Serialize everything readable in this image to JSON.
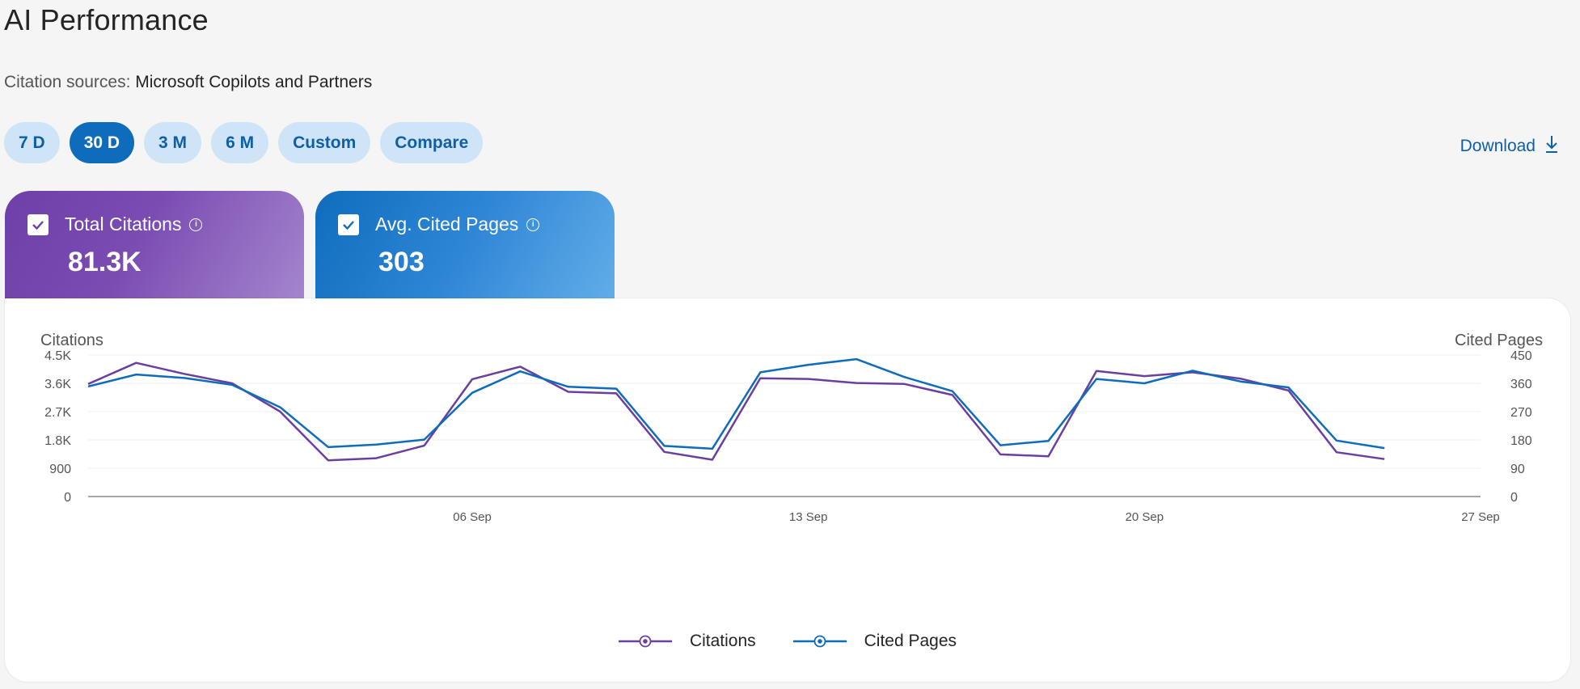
{
  "page": {
    "title": "AI Performance",
    "sources_label": "Citation sources:",
    "sources_value": "Microsoft Copilots and Partners",
    "download_label": "Download"
  },
  "range_buttons": [
    {
      "label": "7 D",
      "active": false
    },
    {
      "label": "30 D",
      "active": true
    },
    {
      "label": "3 M",
      "active": false
    },
    {
      "label": "6 M",
      "active": false
    },
    {
      "label": "Custom",
      "active": false
    },
    {
      "label": "Compare",
      "active": false
    }
  ],
  "metrics": [
    {
      "label": "Total Citations",
      "value": "81.3K",
      "checked": true,
      "color": "#6d3fa8"
    },
    {
      "label": "Avg. Cited Pages",
      "value": "303",
      "checked": true,
      "color": "#0f6cbd"
    }
  ],
  "chart_data": {
    "type": "line",
    "left_axis_label": "Citations",
    "right_axis_label": "Cited Pages",
    "left_ticks": [
      "0",
      "900",
      "1.8K",
      "2.7K",
      "3.6K",
      "4.5K"
    ],
    "right_ticks": [
      "0",
      "90",
      "180",
      "270",
      "360",
      "450"
    ],
    "x_tick_labels": [
      "06 Sep",
      "13 Sep",
      "20 Sep",
      "27 Sep"
    ],
    "left_ylim": [
      0,
      4500
    ],
    "right_ylim": [
      0,
      450
    ],
    "x": [
      "29 Aug",
      "30 Aug",
      "31 Aug",
      "01 Sep",
      "02 Sep",
      "03 Sep",
      "04 Sep",
      "05 Sep",
      "06 Sep",
      "07 Sep",
      "08 Sep",
      "09 Sep",
      "10 Sep",
      "11 Sep",
      "12 Sep",
      "13 Sep",
      "14 Sep",
      "15 Sep",
      "16 Sep",
      "17 Sep",
      "18 Sep",
      "19 Sep",
      "20 Sep",
      "21 Sep",
      "22 Sep",
      "23 Sep",
      "24 Sep",
      "25 Sep",
      "26 Sep",
      "27 Sep"
    ],
    "series": [
      {
        "name": "Citations",
        "axis": "left",
        "color": "#6b3fa0",
        "values": [
          3580,
          4250,
          3900,
          3600,
          2700,
          1150,
          1220,
          1620,
          3730,
          4130,
          3330,
          3280,
          1420,
          1170,
          3760,
          3740,
          3610,
          3580,
          3230,
          1340,
          1280,
          3990,
          3830,
          3950,
          3750,
          3370,
          1410,
          1190
        ]
      },
      {
        "name": "Cited Pages",
        "axis": "right",
        "color": "#0f6cbd",
        "values": [
          350,
          388,
          377,
          355,
          284,
          157,
          165,
          181,
          330,
          398,
          349,
          343,
          161,
          152,
          395,
          419,
          437,
          380,
          335,
          163,
          177,
          374,
          360,
          400,
          366,
          347,
          178,
          154
        ]
      }
    ],
    "legend_position": "bottom-center",
    "grid": true
  }
}
